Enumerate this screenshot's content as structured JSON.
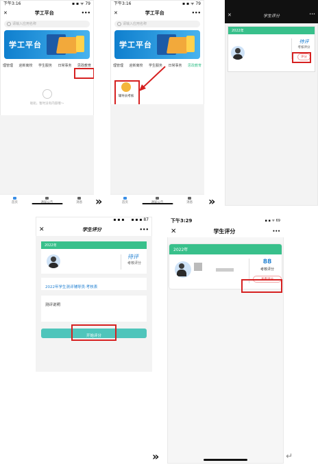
{
  "screen1": {
    "status_time": "下午3:16",
    "status_right": "▪ ▪ ᯤ 79",
    "title": "学工平台",
    "search_placeholder": "请输入应用名称",
    "banner_title": "学工平台",
    "tabs": [
      "理管理",
      "迎新离校",
      "学生服务",
      "日常事务",
      "思政教育"
    ],
    "empty_text": "呃呃，暂时没有内容哦～",
    "nav": [
      "首页",
      "通知公告",
      "消息"
    ]
  },
  "screen2": {
    "status_time": "下午3:16",
    "status_right": "▪ ▪ ᯤ 79",
    "title": "学工平台",
    "search_placeholder": "请输入应用名称",
    "banner_title": "学工平台",
    "tabs": [
      "理管理",
      "迎新离校",
      "学生服务",
      "日常事务",
      "思政教育"
    ],
    "app_label": "辅导员考核",
    "nav": [
      "首页",
      "通知公告",
      "消息"
    ]
  },
  "screen3": {
    "title": "学生评分",
    "year": "2022年",
    "score_label": "待评",
    "score_sub": "考核评分",
    "button": "评分"
  },
  "screen4": {
    "status_left": "▪ ▪ ▪",
    "status_right": "▪ ▪ ▪ 87",
    "title": "学生评分",
    "year": "2022年",
    "score_label": "待评",
    "score_sub": "考核评分",
    "item_title": "2022年学生测评辅导员·考核表",
    "desc_title": "测评说明",
    "start_button": "开始评分"
  },
  "screen5": {
    "status_time": "下午3:29",
    "status_right": "▪ ▪ ᯤ 69",
    "title": "学生评分",
    "year": "2022年",
    "score": "88",
    "score_sub": "考核评分",
    "view_button": "查看评分"
  },
  "arrows": "»",
  "colors": {
    "green": "#38c08b",
    "teal": "#4fc5bb",
    "red": "#d62020",
    "blue": "#1f7fd1"
  }
}
